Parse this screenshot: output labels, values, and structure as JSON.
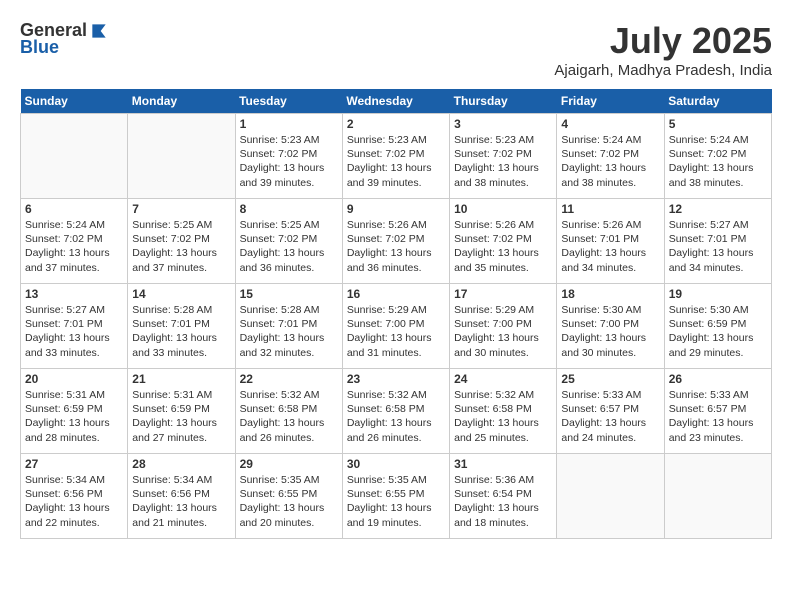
{
  "header": {
    "logo_general": "General",
    "logo_blue": "Blue",
    "month_year": "July 2025",
    "location": "Ajaigarh, Madhya Pradesh, India"
  },
  "weekdays": [
    "Sunday",
    "Monday",
    "Tuesday",
    "Wednesday",
    "Thursday",
    "Friday",
    "Saturday"
  ],
  "weeks": [
    [
      {
        "day": "",
        "info": ""
      },
      {
        "day": "",
        "info": ""
      },
      {
        "day": "1",
        "info": "Sunrise: 5:23 AM\nSunset: 7:02 PM\nDaylight: 13 hours and 39 minutes."
      },
      {
        "day": "2",
        "info": "Sunrise: 5:23 AM\nSunset: 7:02 PM\nDaylight: 13 hours and 39 minutes."
      },
      {
        "day": "3",
        "info": "Sunrise: 5:23 AM\nSunset: 7:02 PM\nDaylight: 13 hours and 38 minutes."
      },
      {
        "day": "4",
        "info": "Sunrise: 5:24 AM\nSunset: 7:02 PM\nDaylight: 13 hours and 38 minutes."
      },
      {
        "day": "5",
        "info": "Sunrise: 5:24 AM\nSunset: 7:02 PM\nDaylight: 13 hours and 38 minutes."
      }
    ],
    [
      {
        "day": "6",
        "info": "Sunrise: 5:24 AM\nSunset: 7:02 PM\nDaylight: 13 hours and 37 minutes."
      },
      {
        "day": "7",
        "info": "Sunrise: 5:25 AM\nSunset: 7:02 PM\nDaylight: 13 hours and 37 minutes."
      },
      {
        "day": "8",
        "info": "Sunrise: 5:25 AM\nSunset: 7:02 PM\nDaylight: 13 hours and 36 minutes."
      },
      {
        "day": "9",
        "info": "Sunrise: 5:26 AM\nSunset: 7:02 PM\nDaylight: 13 hours and 36 minutes."
      },
      {
        "day": "10",
        "info": "Sunrise: 5:26 AM\nSunset: 7:02 PM\nDaylight: 13 hours and 35 minutes."
      },
      {
        "day": "11",
        "info": "Sunrise: 5:26 AM\nSunset: 7:01 PM\nDaylight: 13 hours and 34 minutes."
      },
      {
        "day": "12",
        "info": "Sunrise: 5:27 AM\nSunset: 7:01 PM\nDaylight: 13 hours and 34 minutes."
      }
    ],
    [
      {
        "day": "13",
        "info": "Sunrise: 5:27 AM\nSunset: 7:01 PM\nDaylight: 13 hours and 33 minutes."
      },
      {
        "day": "14",
        "info": "Sunrise: 5:28 AM\nSunset: 7:01 PM\nDaylight: 13 hours and 33 minutes."
      },
      {
        "day": "15",
        "info": "Sunrise: 5:28 AM\nSunset: 7:01 PM\nDaylight: 13 hours and 32 minutes."
      },
      {
        "day": "16",
        "info": "Sunrise: 5:29 AM\nSunset: 7:00 PM\nDaylight: 13 hours and 31 minutes."
      },
      {
        "day": "17",
        "info": "Sunrise: 5:29 AM\nSunset: 7:00 PM\nDaylight: 13 hours and 30 minutes."
      },
      {
        "day": "18",
        "info": "Sunrise: 5:30 AM\nSunset: 7:00 PM\nDaylight: 13 hours and 30 minutes."
      },
      {
        "day": "19",
        "info": "Sunrise: 5:30 AM\nSunset: 6:59 PM\nDaylight: 13 hours and 29 minutes."
      }
    ],
    [
      {
        "day": "20",
        "info": "Sunrise: 5:31 AM\nSunset: 6:59 PM\nDaylight: 13 hours and 28 minutes."
      },
      {
        "day": "21",
        "info": "Sunrise: 5:31 AM\nSunset: 6:59 PM\nDaylight: 13 hours and 27 minutes."
      },
      {
        "day": "22",
        "info": "Sunrise: 5:32 AM\nSunset: 6:58 PM\nDaylight: 13 hours and 26 minutes."
      },
      {
        "day": "23",
        "info": "Sunrise: 5:32 AM\nSunset: 6:58 PM\nDaylight: 13 hours and 26 minutes."
      },
      {
        "day": "24",
        "info": "Sunrise: 5:32 AM\nSunset: 6:58 PM\nDaylight: 13 hours and 25 minutes."
      },
      {
        "day": "25",
        "info": "Sunrise: 5:33 AM\nSunset: 6:57 PM\nDaylight: 13 hours and 24 minutes."
      },
      {
        "day": "26",
        "info": "Sunrise: 5:33 AM\nSunset: 6:57 PM\nDaylight: 13 hours and 23 minutes."
      }
    ],
    [
      {
        "day": "27",
        "info": "Sunrise: 5:34 AM\nSunset: 6:56 PM\nDaylight: 13 hours and 22 minutes."
      },
      {
        "day": "28",
        "info": "Sunrise: 5:34 AM\nSunset: 6:56 PM\nDaylight: 13 hours and 21 minutes."
      },
      {
        "day": "29",
        "info": "Sunrise: 5:35 AM\nSunset: 6:55 PM\nDaylight: 13 hours and 20 minutes."
      },
      {
        "day": "30",
        "info": "Sunrise: 5:35 AM\nSunset: 6:55 PM\nDaylight: 13 hours and 19 minutes."
      },
      {
        "day": "31",
        "info": "Sunrise: 5:36 AM\nSunset: 6:54 PM\nDaylight: 13 hours and 18 minutes."
      },
      {
        "day": "",
        "info": ""
      },
      {
        "day": "",
        "info": ""
      }
    ]
  ]
}
